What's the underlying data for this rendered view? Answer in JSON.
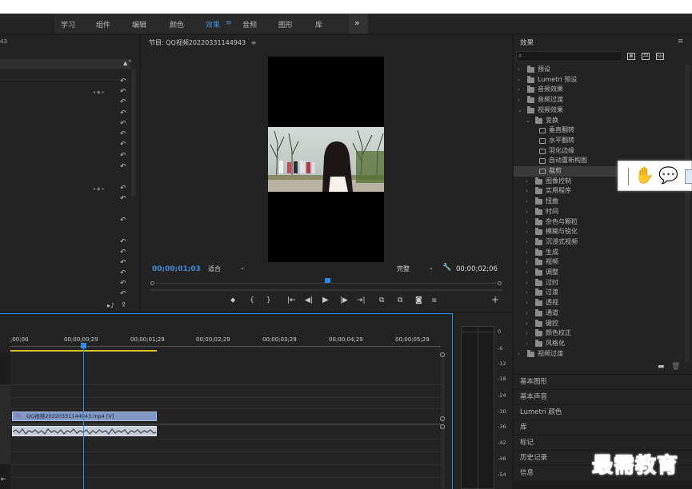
{
  "workspace_tabs": [
    {
      "label": "学习",
      "x": 0
    },
    {
      "label": "组件"
    },
    {
      "label": "编辑"
    },
    {
      "label": "颜色"
    },
    {
      "label": "效果",
      "active": true
    },
    {
      "label": "音频"
    },
    {
      "label": "图形"
    },
    {
      "label": "库"
    }
  ],
  "workspace_more": "»",
  "left_panel": {
    "label_fragment": "43"
  },
  "program_monitor": {
    "title": "节目: QQ视频20220331144943",
    "menu_glyph": "≡",
    "timecode_current": "00;00;01;03",
    "zoom_value": "适合",
    "quality_value": "完整",
    "timecode_duration": "00;00;02;06"
  },
  "effects_panel": {
    "title": "效果",
    "menu_glyph": "≡",
    "search_placeholder": "",
    "badge_labels": [
      "32",
      "YUV"
    ],
    "items": [
      {
        "label": "预设",
        "level": 0,
        "expanded": false,
        "type": "folder-star"
      },
      {
        "label": "Lumetri 预设",
        "level": 0,
        "expanded": false,
        "type": "folder-star"
      },
      {
        "label": "音频效果",
        "level": 0,
        "expanded": false,
        "type": "folder"
      },
      {
        "label": "音频过渡",
        "level": 0,
        "expanded": false,
        "type": "folder"
      },
      {
        "label": "视频效果",
        "level": 0,
        "expanded": true,
        "type": "folder"
      },
      {
        "label": "变换",
        "level": 1,
        "expanded": true,
        "type": "folder"
      },
      {
        "label": "垂直翻转",
        "level": 2,
        "type": "effect"
      },
      {
        "label": "水平翻转",
        "level": 2,
        "type": "effect"
      },
      {
        "label": "羽化边缘",
        "level": 2,
        "type": "effect"
      },
      {
        "label": "自动重新构图",
        "level": 2,
        "type": "effect"
      },
      {
        "label": "裁剪",
        "level": 2,
        "type": "effect",
        "selected": true
      },
      {
        "label": "图像控制",
        "level": 1,
        "expanded": false,
        "type": "folder"
      },
      {
        "label": "实用程序",
        "level": 1,
        "expanded": false,
        "type": "folder"
      },
      {
        "label": "扭曲",
        "level": 1,
        "expanded": false,
        "type": "folder"
      },
      {
        "label": "时间",
        "level": 1,
        "expanded": false,
        "type": "folder"
      },
      {
        "label": "杂色与颗粒",
        "level": 1,
        "expanded": false,
        "type": "folder"
      },
      {
        "label": "模糊与锐化",
        "level": 1,
        "expanded": false,
        "type": "folder"
      },
      {
        "label": "沉浸式视频",
        "level": 1,
        "expanded": false,
        "type": "folder"
      },
      {
        "label": "生成",
        "level": 1,
        "expanded": false,
        "type": "folder"
      },
      {
        "label": "视频",
        "level": 1,
        "expanded": false,
        "type": "folder"
      },
      {
        "label": "调整",
        "level": 1,
        "expanded": false,
        "type": "folder"
      },
      {
        "label": "过时",
        "level": 1,
        "expanded": false,
        "type": "folder"
      },
      {
        "label": "过渡",
        "level": 1,
        "expanded": false,
        "type": "folder"
      },
      {
        "label": "透视",
        "level": 1,
        "expanded": false,
        "type": "folder"
      },
      {
        "label": "通道",
        "level": 1,
        "expanded": false,
        "type": "folder"
      },
      {
        "label": "键控",
        "level": 1,
        "expanded": false,
        "type": "folder"
      },
      {
        "label": "颜色校正",
        "level": 1,
        "expanded": false,
        "type": "folder"
      },
      {
        "label": "风格化",
        "level": 1,
        "expanded": false,
        "type": "folder"
      },
      {
        "label": "视频过渡",
        "level": 0,
        "expanded": false,
        "type": "folder"
      }
    ]
  },
  "accordion_panels": [
    "基本图形",
    "基本声音",
    "Lumetri 颜色",
    "库",
    "标记",
    "历史记录",
    "信息"
  ],
  "timeline": {
    "ruler_labels": [
      ";00;00",
      "00;00;00;29",
      "00;00;01;29",
      "00;00;02;29",
      "00;00;03;29",
      "00;00;04;29",
      "00;00;05;29"
    ],
    "video_clip_label": "QQ视频20220331144943.mp4 [V]",
    "fx_badge": "fx"
  },
  "audio_meter_labels": [
    "0",
    "-6",
    "-12",
    "-18",
    "-24",
    "-30",
    "-36",
    "-42",
    "-48",
    "-54"
  ],
  "watermark": "最需教育",
  "colors": {
    "accent_blue": "#2e8ce6",
    "timecode_blue": "#3d8bd9",
    "video_clip": "#7f98c4",
    "audio_clip": "#c8cdd6",
    "yellow_bar": "#d4c32f",
    "watermark_blue": "#1e3fa0"
  }
}
